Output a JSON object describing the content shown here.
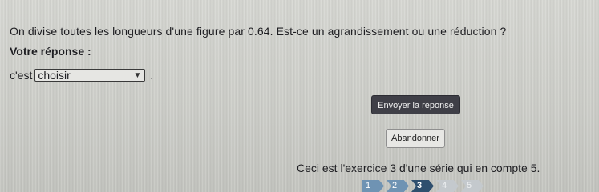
{
  "exercise": {
    "question": "On divise toutes les longueurs d'une figure par 0.64. Est-ce un agrandissement ou une réduction ?",
    "answer_label": "Votre réponse :",
    "answer_prefix": "c'est",
    "select_value": "choisir",
    "answer_suffix": "."
  },
  "buttons": {
    "submit_label": "Envoyer la réponse",
    "cancel_label": "Abandonner"
  },
  "series": {
    "info": "Ceci est l'exercice 3 d'une série qui en compte 5.",
    "steps": [
      {
        "label": "1",
        "state": "done"
      },
      {
        "label": "2",
        "state": "done"
      },
      {
        "label": "3",
        "state": "current"
      },
      {
        "label": "4",
        "state": "todo"
      },
      {
        "label": "5",
        "state": "todo"
      }
    ]
  }
}
